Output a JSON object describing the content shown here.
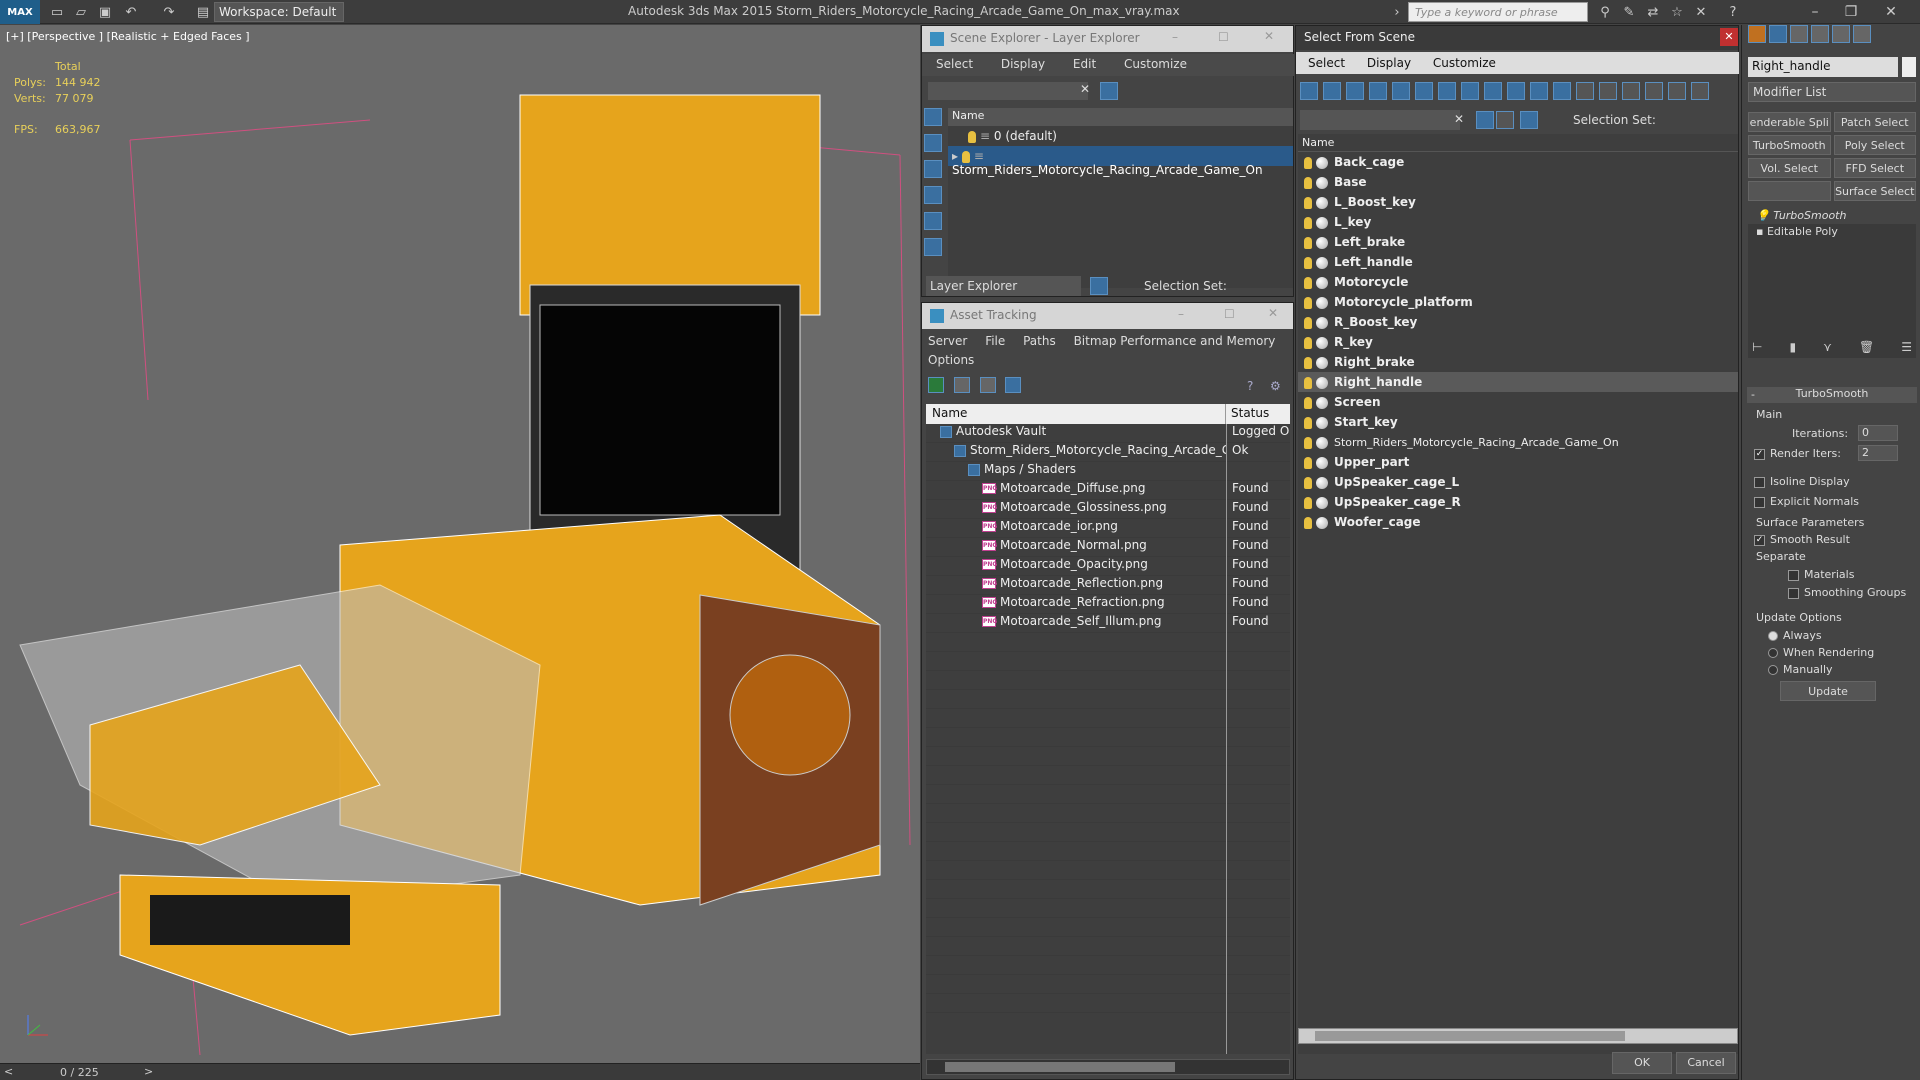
{
  "app": {
    "logo": "MAX",
    "workspace": "Workspace: Default",
    "title": "Autodesk 3ds Max  2015    Storm_Riders_Motorcycle_Racing_Arcade_Game_On_max_vray.max",
    "search_placeholder": "Type a keyword or phrase"
  },
  "viewport": {
    "label": "[+] [Perspective ] [Realistic + Edged Faces ]",
    "stats_header": "Total",
    "polys_label": "Polys:",
    "polys_value": "144 942",
    "verts_label": "Verts:",
    "verts_value": "77 079",
    "fps_label": "FPS:",
    "fps_value": "663,967",
    "frame": "0 / 225"
  },
  "scene_explorer": {
    "title": "Scene Explorer - Layer Explorer",
    "menu": [
      "Select",
      "Display",
      "Edit",
      "Customize"
    ],
    "col_name": "Name",
    "layers": [
      "0 (default)",
      "Storm_Riders_Motorcycle_Racing_Arcade_Game_On"
    ],
    "footer_left": "Layer Explorer",
    "footer_right": "Selection Set:"
  },
  "asset_tracking": {
    "title": "Asset Tracking",
    "menu": [
      "Server",
      "File",
      "Paths",
      "Bitmap Performance and Memory"
    ],
    "menu2": "Options",
    "col_name": "Name",
    "col_status": "Status",
    "rows": [
      {
        "name": "Autodesk Vault",
        "status": "Logged Ou",
        "indent": 0
      },
      {
        "name": "Storm_Riders_Motorcycle_Racing_Arcade_G...",
        "status": "Ok",
        "indent": 1
      },
      {
        "name": "Maps / Shaders",
        "status": "",
        "indent": 2
      },
      {
        "name": "Motoarcade_Diffuse.png",
        "status": "Found",
        "indent": 3
      },
      {
        "name": "Motoarcade_Glossiness.png",
        "status": "Found",
        "indent": 3
      },
      {
        "name": "Motoarcade_ior.png",
        "status": "Found",
        "indent": 3
      },
      {
        "name": "Motoarcade_Normal.png",
        "status": "Found",
        "indent": 3
      },
      {
        "name": "Motoarcade_Opacity.png",
        "status": "Found",
        "indent": 3
      },
      {
        "name": "Motoarcade_Reflection.png",
        "status": "Found",
        "indent": 3
      },
      {
        "name": "Motoarcade_Refraction.png",
        "status": "Found",
        "indent": 3
      },
      {
        "name": "Motoarcade_Self_Illum.png",
        "status": "Found",
        "indent": 3
      }
    ]
  },
  "select_from_scene": {
    "title": "Select From Scene",
    "menu": [
      "Select",
      "Display",
      "Customize"
    ],
    "selection_set": "Selection Set:",
    "col_name": "Name",
    "objects": [
      "Back_cage",
      "Base",
      "L_Boost_key",
      "L_key",
      "Left_brake",
      "Left_handle",
      "Motorcycle",
      "Motorcycle_platform",
      "R_Boost_key",
      "R_key",
      "Right_brake",
      "Right_handle",
      "Screen",
      "Start_key",
      "Storm_Riders_Motorcycle_Racing_Arcade_Game_On",
      "Upper_part",
      "UpSpeaker_cage_L",
      "UpSpeaker_cage_R",
      "Woofer_cage"
    ],
    "selected": "Right_handle",
    "ok": "OK",
    "cancel": "Cancel"
  },
  "command_panel": {
    "object_name": "Right_handle",
    "modifier_list": "Modifier List",
    "buttons": [
      "enderable Spli",
      "Patch Select",
      "TurboSmooth",
      "Poly Select",
      "Vol. Select",
      "FFD Select",
      "",
      "Surface Select"
    ],
    "stack": [
      "TurboSmooth",
      "Editable Poly"
    ],
    "rollout": "TurboSmooth",
    "main": "Main",
    "iterations_label": "Iterations:",
    "iterations_value": "0",
    "render_iters_label": "Render Iters:",
    "render_iters_value": "2",
    "isoline": "Isoline Display",
    "explicit_normals": "Explicit Normals",
    "surface_params": "Surface Parameters",
    "smooth_result": "Smooth Result",
    "separate": "Separate",
    "materials": "Materials",
    "smoothing_groups": "Smoothing Groups",
    "update_options": "Update Options",
    "always": "Always",
    "when_rendering": "When Rendering",
    "manually": "Manually",
    "update": "Update"
  }
}
